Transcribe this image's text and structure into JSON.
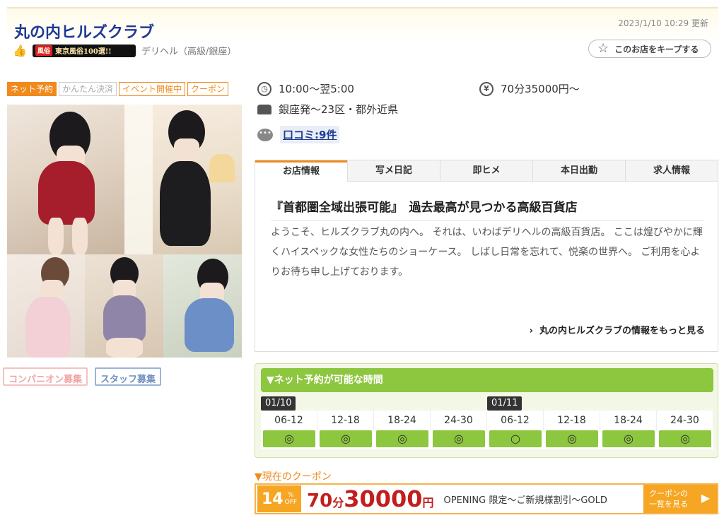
{
  "header": {
    "title": "丸の内ヒルズクラブ",
    "updated": "2023/1/10 10:29 更新",
    "rank_badge_left": "風俗",
    "rank_badge_text": "東京風俗100選!!",
    "category": "デリヘル（高級/銀座）",
    "keep_label": "このお店をキープする"
  },
  "tags": [
    "ネット予約",
    "かんたん決済",
    "イベント開催中",
    "クーポン"
  ],
  "recruit": [
    "コンパニオン募集",
    "スタッフ募集"
  ],
  "info": {
    "hours": "10:00〜翌5:00",
    "price": "70分35000円〜",
    "area": "銀座発〜23区・都外近県",
    "reviews": "口コミ:9件"
  },
  "tabs": [
    "お店情報",
    "写メ日記",
    "即ヒメ",
    "本日出勤",
    "求人情報"
  ],
  "panel": {
    "title": "『首都圏全域出張可能』　過去最高が見つかる高級百貨店",
    "body": "ようこそ、ヒルズクラブ丸の内へ。 それは、いわばデリヘルの高級百貨店。 ここは煌びやかに輝くハイスペックな女性たちのショーケース。 しばし日常を忘れて、悦楽の世界へ。 ご利用を心よりお待ち申し上げております。",
    "more": "丸の内ヒルズクラブの情報をもっと見る"
  },
  "reservation": {
    "heading": "▼ネット予約が可能な時間",
    "dates": [
      "01/10",
      "01/11"
    ],
    "slots": [
      {
        "time": "06-12",
        "mark": "◎"
      },
      {
        "time": "12-18",
        "mark": "◎"
      },
      {
        "time": "18-24",
        "mark": "◎"
      },
      {
        "time": "24-30",
        "mark": "◎"
      },
      {
        "time": "06-12",
        "mark": "○"
      },
      {
        "time": "12-18",
        "mark": "◎"
      },
      {
        "time": "18-24",
        "mark": "◎"
      },
      {
        "time": "24-30",
        "mark": "◎"
      }
    ]
  },
  "coupon": {
    "label": "▼現在のクーポン",
    "percent": "14",
    "percent_unit": "%",
    "off": "OFF",
    "price_minutes": "70",
    "price_min_unit": "分",
    "price_amount": "30000",
    "price_yen": "円",
    "description": "OPENING 限定〜ご新規様割引〜GOLD",
    "button_line1": "クーポンの",
    "button_line2": "一覧を見る"
  }
}
